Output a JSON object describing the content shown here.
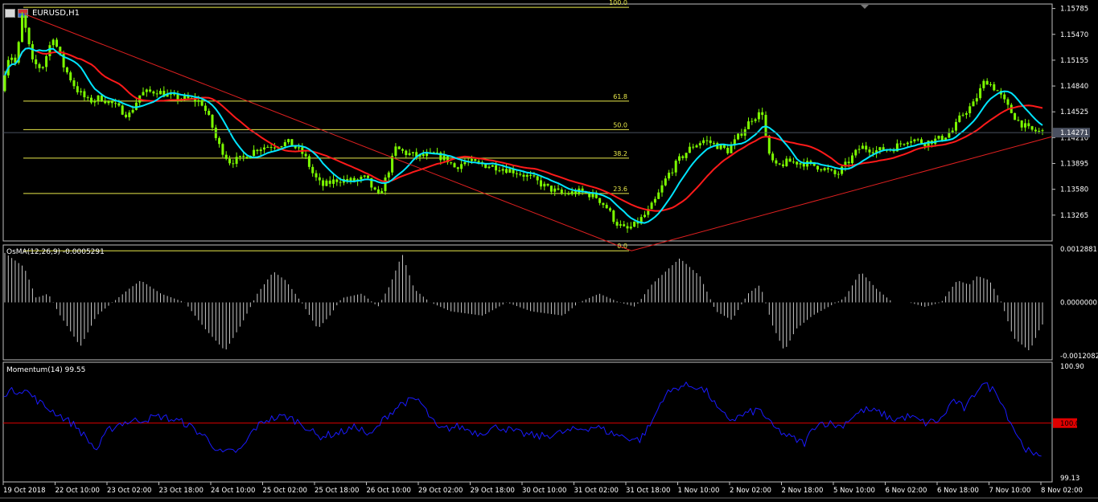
{
  "window": {
    "symbol_label": "EURUSD,H1",
    "icons": [
      "chart-window-icon",
      "flag-icon"
    ]
  },
  "colors": {
    "background": "#000000",
    "candle": "#7CFC00",
    "ma_fast": "#00E5FF",
    "ma_slow": "#FF1A1A",
    "trendline": "#E02020",
    "fibo": "#E8E84A",
    "osma": "#C8C8C8",
    "momentum": "#1a1aff",
    "momentum_level": "#E00000",
    "axis_text": "#FFFFFF",
    "frame": "#C0C0C0"
  },
  "chart_data": [
    {
      "type": "candlestick",
      "symbol": "EURUSD",
      "timeframe": "H1",
      "ylim": [
        1.1295,
        1.1584
      ],
      "y_ticks": [
        "1.15785",
        "1.15470",
        "1.15155",
        "1.14840",
        "1.14525",
        "1.14210",
        "1.13895",
        "1.13580",
        "1.13265"
      ],
      "current_price": "1.14271",
      "path": [
        [
          0,
          1.1478
        ],
        [
          12,
          1.1525
        ],
        [
          20,
          1.151
        ],
        [
          28,
          1.1572
        ],
        [
          40,
          1.1513
        ],
        [
          52,
          1.1505
        ],
        [
          66,
          1.1545
        ],
        [
          78,
          1.151
        ],
        [
          95,
          1.148
        ],
        [
          110,
          1.1465
        ],
        [
          125,
          1.147
        ],
        [
          140,
          1.1462
        ],
        [
          160,
          1.1448
        ],
        [
          175,
          1.1475
        ],
        [
          195,
          1.1478
        ],
        [
          215,
          1.147
        ],
        [
          235,
          1.1468
        ],
        [
          250,
          1.1465
        ],
        [
          262,
          1.144
        ],
        [
          270,
          1.1415
        ],
        [
          285,
          1.1392
        ],
        [
          300,
          1.1395
        ],
        [
          320,
          1.1408
        ],
        [
          340,
          1.1412
        ],
        [
          360,
          1.1415
        ],
        [
          378,
          1.14
        ],
        [
          390,
          1.1375
        ],
        [
          400,
          1.1362
        ],
        [
          420,
          1.137
        ],
        [
          440,
          1.1368
        ],
        [
          455,
          1.1372
        ],
        [
          470,
          1.1348
        ],
        [
          480,
          1.1372
        ],
        [
          492,
          1.1408
        ],
        [
          505,
          1.1402
        ],
        [
          520,
          1.1398
        ],
        [
          540,
          1.14
        ],
        [
          555,
          1.1395
        ],
        [
          565,
          1.1385
        ],
        [
          580,
          1.1392
        ],
        [
          600,
          1.1388
        ],
        [
          620,
          1.1385
        ],
        [
          640,
          1.138
        ],
        [
          660,
          1.1372
        ],
        [
          680,
          1.136
        ],
        [
          700,
          1.1352
        ],
        [
          720,
          1.1355
        ],
        [
          740,
          1.135
        ],
        [
          755,
          1.1335
        ],
        [
          765,
          1.1318
        ],
        [
          778,
          1.1308
        ],
        [
          790,
          1.1315
        ],
        [
          805,
          1.133
        ],
        [
          815,
          1.1345
        ],
        [
          830,
          1.1375
        ],
        [
          845,
          1.1395
        ],
        [
          860,
          1.141
        ],
        [
          875,
          1.1418
        ],
        [
          890,
          1.1412
        ],
        [
          905,
          1.1405
        ],
        [
          920,
          1.1425
        ],
        [
          935,
          1.1445
        ],
        [
          948,
          1.1452
        ],
        [
          955,
          1.14
        ],
        [
          965,
          1.1385
        ],
        [
          980,
          1.1392
        ],
        [
          1000,
          1.139
        ],
        [
          1020,
          1.1385
        ],
        [
          1040,
          1.1375
        ],
        [
          1055,
          1.1392
        ],
        [
          1070,
          1.141
        ],
        [
          1090,
          1.1405
        ],
        [
          1110,
          1.1408
        ],
        [
          1130,
          1.142
        ],
        [
          1150,
          1.1415
        ],
        [
          1170,
          1.142
        ],
        [
          1185,
          1.143
        ],
        [
          1195,
          1.1448
        ],
        [
          1210,
          1.1462
        ],
        [
          1225,
          1.1492
        ],
        [
          1240,
          1.1478
        ],
        [
          1255,
          1.1455
        ],
        [
          1265,
          1.1442
        ],
        [
          1280,
          1.143
        ],
        [
          1295,
          1.1428
        ]
      ],
      "fibonacci": [
        {
          "level": "100.0",
          "price": 1.158
        },
        {
          "level": "61.8",
          "price": 1.14656
        },
        {
          "level": "50.0",
          "price": 1.14308
        },
        {
          "level": "38.2",
          "price": 1.1396
        },
        {
          "level": "23.6",
          "price": 1.13529
        },
        {
          "level": "0.0",
          "price": 1.1283
        }
      ],
      "trendlines": [
        {
          "from": [
            30,
            1.1572
          ],
          "to": [
            785,
            1.1283
          ]
        },
        {
          "from": [
            785,
            1.1283
          ],
          "to": [
            1307,
            1.1422
          ]
        }
      ]
    },
    {
      "type": "histogram",
      "title": "OsMA(12,26,9) -0.0005291",
      "ylim": [
        -0.0013,
        0.0013
      ],
      "y_ticks": [
        "0.0012881",
        "0.0000000",
        "-0.0012082"
      ],
      "current_value": "-0.0005291",
      "shape": [
        [
          0,
          0.0012
        ],
        [
          30,
          0.0008
        ],
        [
          45,
          0.0001
        ],
        [
          60,
          0.0002
        ],
        [
          75,
          -0.0003
        ],
        [
          100,
          -0.001
        ],
        [
          120,
          -0.0003
        ],
        [
          140,
          0.0
        ],
        [
          160,
          0.0003
        ],
        [
          175,
          0.0005
        ],
        [
          200,
          0.0002
        ],
        [
          230,
          0.0
        ],
        [
          255,
          -0.0006
        ],
        [
          280,
          -0.0011
        ],
        [
          300,
          -0.0005
        ],
        [
          320,
          0.0002
        ],
        [
          340,
          0.0007
        ],
        [
          355,
          0.0005
        ],
        [
          375,
          0.0
        ],
        [
          395,
          -0.0006
        ],
        [
          410,
          -0.0003
        ],
        [
          425,
          0.0001
        ],
        [
          450,
          0.0002
        ],
        [
          470,
          -0.0001
        ],
        [
          485,
          0.0004
        ],
        [
          500,
          0.0011
        ],
        [
          515,
          0.0003
        ],
        [
          535,
          0.0
        ],
        [
          560,
          -0.0002
        ],
        [
          600,
          -0.0003
        ],
        [
          630,
          0.0
        ],
        [
          660,
          -0.0002
        ],
        [
          700,
          -0.0003
        ],
        [
          720,
          0.0
        ],
        [
          745,
          0.0002
        ],
        [
          770,
          0.0
        ],
        [
          790,
          -0.0001
        ],
        [
          810,
          0.0004
        ],
        [
          845,
          0.001
        ],
        [
          870,
          0.0006
        ],
        [
          890,
          -0.0002
        ],
        [
          910,
          -0.0004
        ],
        [
          930,
          0.0002
        ],
        [
          945,
          0.0004
        ],
        [
          960,
          -0.0005
        ],
        [
          975,
          -0.0011
        ],
        [
          990,
          -0.0006
        ],
        [
          1010,
          -0.0003
        ],
        [
          1030,
          -0.0001
        ],
        [
          1050,
          0.0001
        ],
        [
          1070,
          0.0007
        ],
        [
          1090,
          0.0003
        ],
        [
          1110,
          0.0
        ],
        [
          1130,
          0.0
        ],
        [
          1150,
          -0.0001
        ],
        [
          1170,
          0.0
        ],
        [
          1190,
          0.0005
        ],
        [
          1205,
          0.0004
        ],
        [
          1215,
          0.0006
        ],
        [
          1230,
          0.0005
        ],
        [
          1245,
          0.0
        ],
        [
          1260,
          -0.0008
        ],
        [
          1280,
          -0.0011
        ],
        [
          1295,
          -0.0005
        ]
      ]
    },
    {
      "type": "line",
      "title": "Momentum(14) 99.55",
      "ylim": [
        99.13,
        100.9
      ],
      "y_ticks": [
        "100.90",
        "99.13"
      ],
      "level": {
        "value": 100.0,
        "label": "100.00"
      },
      "current_value": "99.55",
      "path": [
        [
          5,
          100.45
        ],
        [
          30,
          100.5
        ],
        [
          55,
          100.25
        ],
        [
          70,
          100.15
        ],
        [
          95,
          99.95
        ],
        [
          120,
          99.6
        ],
        [
          135,
          99.9
        ],
        [
          150,
          100.0
        ],
        [
          175,
          100.05
        ],
        [
          200,
          100.1
        ],
        [
          230,
          100.0
        ],
        [
          255,
          99.8
        ],
        [
          275,
          99.55
        ],
        [
          300,
          99.6
        ],
        [
          315,
          99.9
        ],
        [
          330,
          100.05
        ],
        [
          355,
          100.1
        ],
        [
          375,
          100.0
        ],
        [
          395,
          99.8
        ],
        [
          420,
          99.85
        ],
        [
          445,
          99.95
        ],
        [
          460,
          99.8
        ],
        [
          480,
          100.1
        ],
        [
          500,
          100.3
        ],
        [
          520,
          100.35
        ],
        [
          545,
          99.9
        ],
        [
          570,
          99.95
        ],
        [
          595,
          99.85
        ],
        [
          620,
          99.95
        ],
        [
          645,
          99.85
        ],
        [
          670,
          99.8
        ],
        [
          695,
          99.85
        ],
        [
          715,
          99.9
        ],
        [
          740,
          99.95
        ],
        [
          760,
          99.85
        ],
        [
          775,
          99.8
        ],
        [
          795,
          99.75
        ],
        [
          810,
          100.0
        ],
        [
          825,
          100.4
        ],
        [
          845,
          100.55
        ],
        [
          865,
          100.55
        ],
        [
          880,
          100.45
        ],
        [
          895,
          100.15
        ],
        [
          910,
          100.05
        ],
        [
          930,
          100.15
        ],
        [
          945,
          100.2
        ],
        [
          960,
          99.95
        ],
        [
          980,
          99.8
        ],
        [
          1000,
          99.7
        ],
        [
          1015,
          100.0
        ],
        [
          1030,
          100.0
        ],
        [
          1045,
          99.95
        ],
        [
          1060,
          100.1
        ],
        [
          1075,
          100.2
        ],
        [
          1095,
          100.15
        ],
        [
          1110,
          100.05
        ],
        [
          1130,
          100.1
        ],
        [
          1150,
          100.0
        ],
        [
          1170,
          100.05
        ],
        [
          1185,
          100.35
        ],
        [
          1200,
          100.2
        ],
        [
          1220,
          100.6
        ],
        [
          1240,
          100.45
        ],
        [
          1255,
          100.05
        ],
        [
          1270,
          99.7
        ],
        [
          1285,
          99.5
        ],
        [
          1295,
          99.55
        ]
      ]
    }
  ],
  "time_axis": {
    "labels": [
      "19 Oct 2018",
      "22 Oct 10:00",
      "23 Oct 02:00",
      "23 Oct 18:00",
      "24 Oct 10:00",
      "25 Oct 02:00",
      "25 Oct 18:00",
      "26 Oct 10:00",
      "29 Oct 02:00",
      "29 Oct 18:00",
      "30 Oct 10:00",
      "31 Oct 02:00",
      "31 Oct 18:00",
      "1 Nov 10:00",
      "2 Nov 02:00",
      "2 Nov 18:00",
      "5 Nov 10:00",
      "6 Nov 02:00",
      "6 Nov 18:00",
      "7 Nov 10:00",
      "8 Nov 02:00"
    ]
  }
}
